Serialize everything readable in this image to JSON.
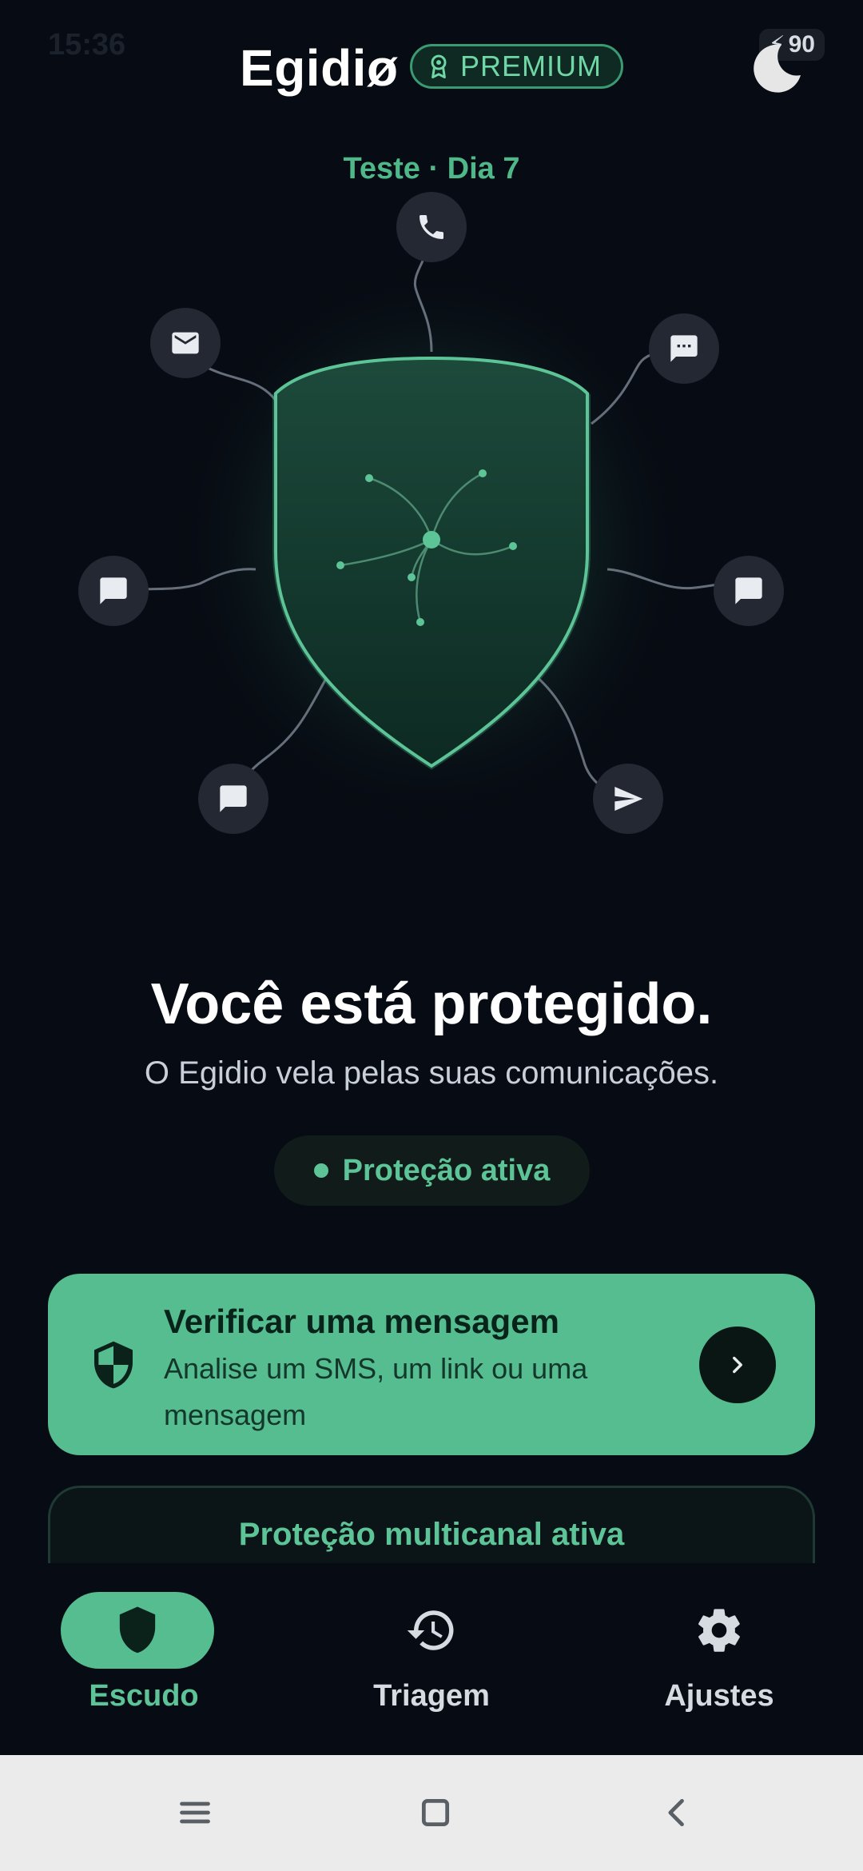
{
  "status_bar": {
    "time": "15:36",
    "battery": "90"
  },
  "header": {
    "app_name": "Egidiø",
    "badge": "PREMIUM"
  },
  "trial_label": "Teste · Dia 7",
  "hero": {
    "title": "Você está protegido.",
    "subtitle": "O Egidio vela pelas suas comunicações.",
    "status": "Proteção ativa"
  },
  "verify_card": {
    "title": "Verificar uma mensagem",
    "description": "Analise um SMS, um link ou uma mensagem"
  },
  "multichannel_card": {
    "title": "Proteção multicanal ativa"
  },
  "bottom_nav": [
    {
      "label": "Escudo",
      "icon": "shield-icon",
      "active": true
    },
    {
      "label": "Triagem",
      "icon": "history-icon",
      "active": false
    },
    {
      "label": "Ajustes",
      "icon": "gear-icon",
      "active": false
    }
  ],
  "colors": {
    "accent": "#55bd8f",
    "background": "#070b13"
  }
}
